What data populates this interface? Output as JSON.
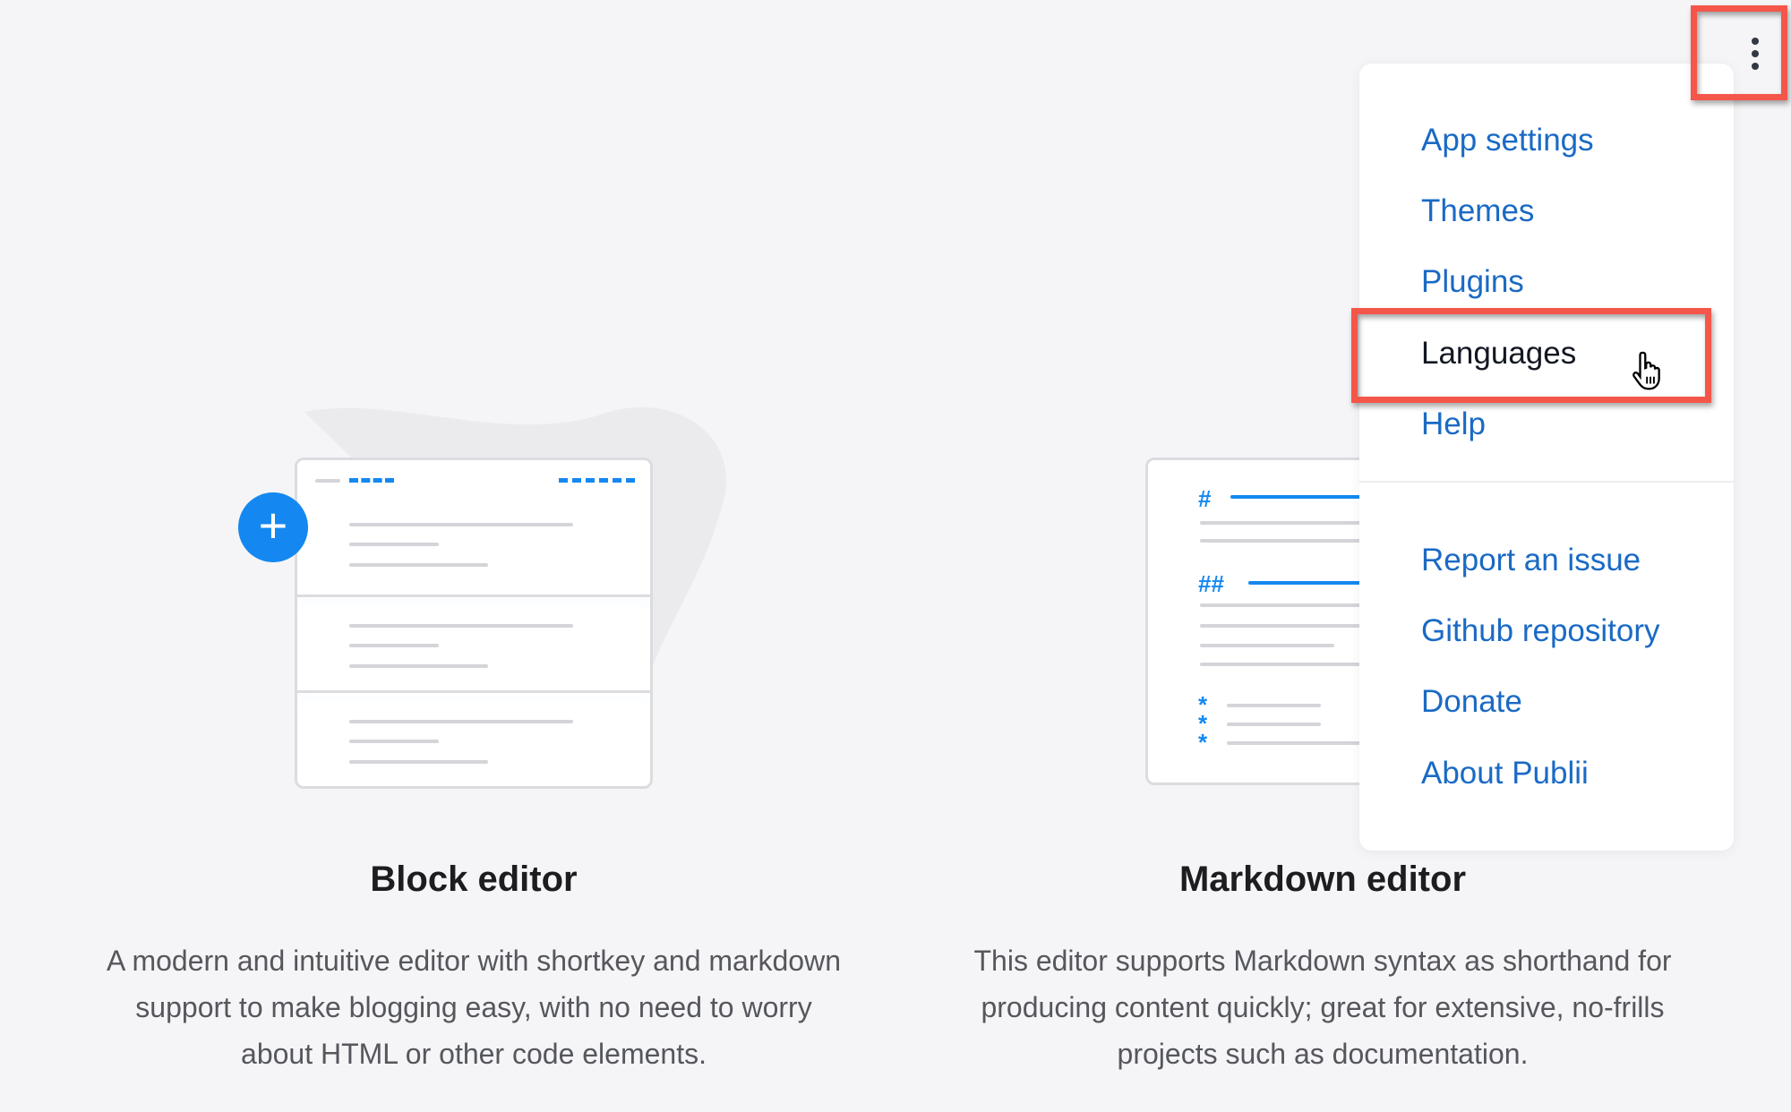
{
  "menu": {
    "items": [
      {
        "label": "App settings"
      },
      {
        "label": "Themes"
      },
      {
        "label": "Plugins"
      },
      {
        "label": "Languages"
      },
      {
        "label": "Help"
      },
      {
        "label": "Report an issue"
      },
      {
        "label": "Github repository"
      },
      {
        "label": "Donate"
      },
      {
        "label": "About Publii"
      }
    ],
    "hovered": "Languages"
  },
  "editors": [
    {
      "title": "Block editor",
      "description_lines": [
        "A modern and intuitive editor with shortkey and markdown",
        "support to make blogging easy, with no need to worry",
        "about HTML or other code elements."
      ]
    },
    {
      "title": "Markdown editor",
      "description_lines": [
        "This editor supports Markdown syntax as shorthand for",
        "producing content quickly; great for extensive, no-frills",
        "projects such as documentation."
      ]
    }
  ],
  "illustration": {
    "md_symbols": [
      "#",
      "##",
      "*",
      "*",
      "*"
    ],
    "plus": "+"
  },
  "colors": {
    "accent": "#1488f0",
    "link": "#1a6ac4",
    "highlight": "#f4564a",
    "background": "#f5f5f7"
  },
  "icons": {
    "menu": "kebab-vertical-icon",
    "cursor": "hand-pointer-icon",
    "add": "plus-icon"
  }
}
